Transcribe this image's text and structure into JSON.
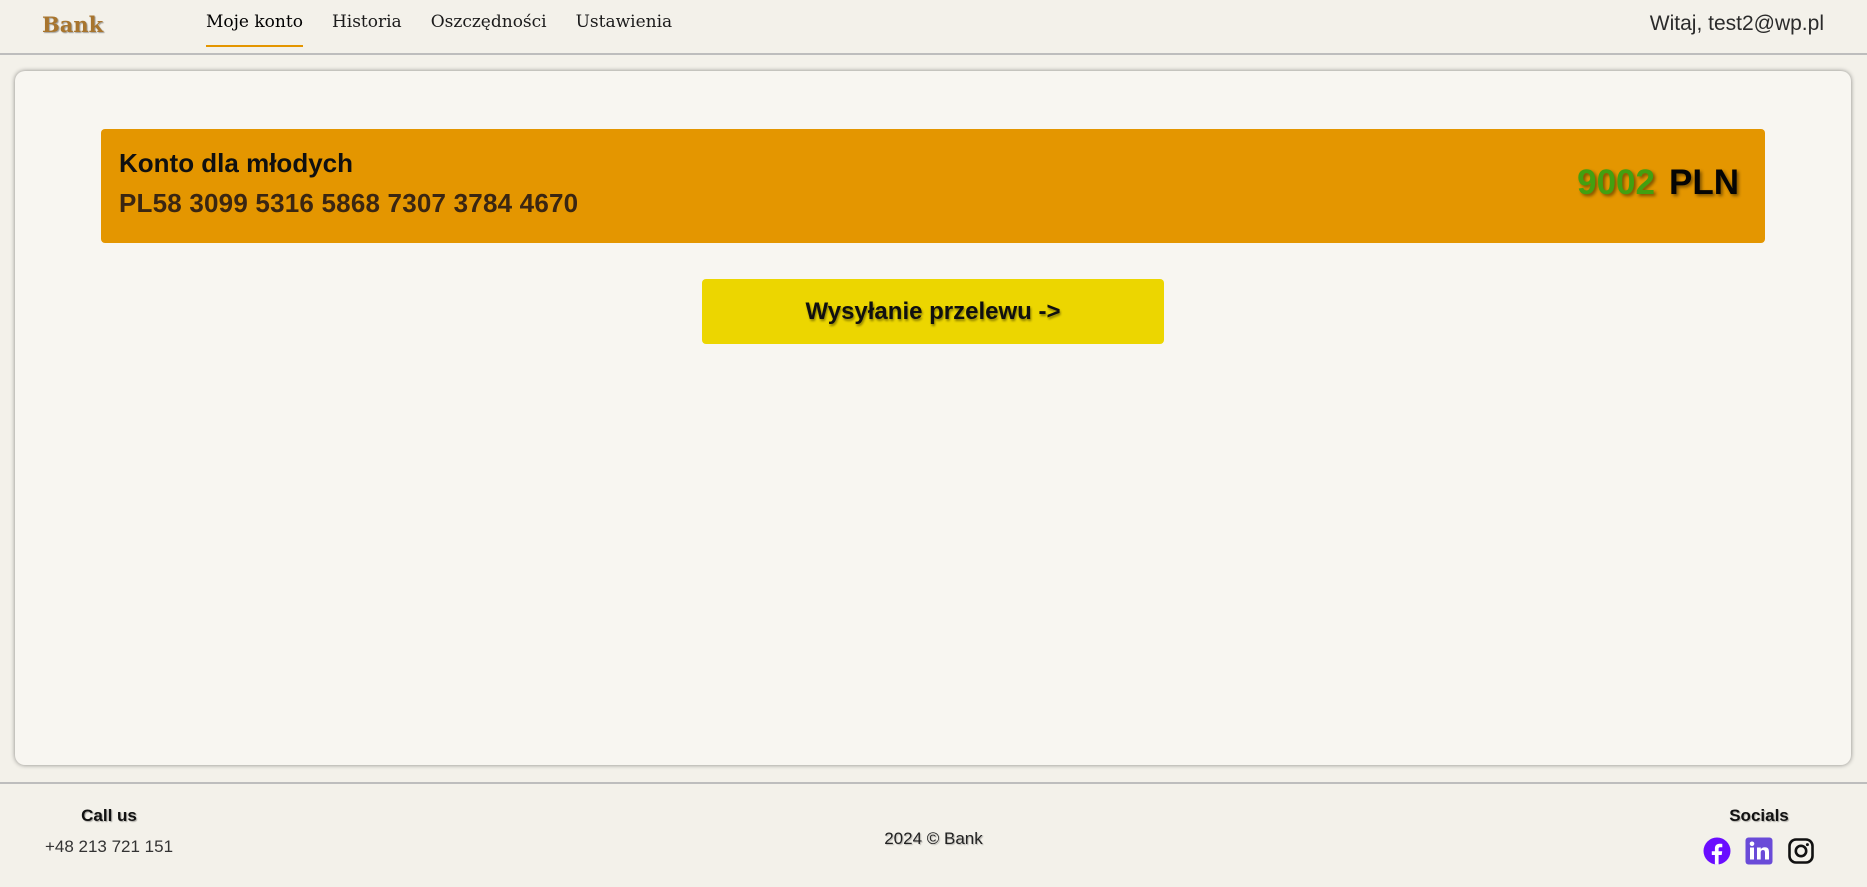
{
  "header": {
    "logo": "Bank",
    "nav": [
      {
        "label": "Moje konto",
        "active": true
      },
      {
        "label": "Historia",
        "active": false
      },
      {
        "label": "Oszczędności",
        "active": false
      },
      {
        "label": "Ustawienia",
        "active": false
      }
    ],
    "greeting": "Witaj, test2@wp.pl"
  },
  "account": {
    "name": "Konto dla młodych",
    "iban": "PL58 3099 5316 5868 7307 3784 4670",
    "balance": "9002",
    "currency": "PLN"
  },
  "actions": {
    "transfer_label": "Wysyłanie przelewu ->"
  },
  "footer": {
    "call_heading": "Call us",
    "phone": "+48 213 721 151",
    "copyright": "2024 © Bank",
    "socials_heading": "Socials",
    "socials": [
      {
        "icon": "facebook-icon",
        "color": "#6a0dff"
      },
      {
        "icon": "linkedin-icon",
        "color": "#6a4bd8"
      },
      {
        "icon": "instagram-icon",
        "color": "#111111"
      }
    ]
  },
  "colors": {
    "accent": "#e49600",
    "button": "#ecd600",
    "balance_amount": "#43a010",
    "background": "#f3f1ea"
  }
}
